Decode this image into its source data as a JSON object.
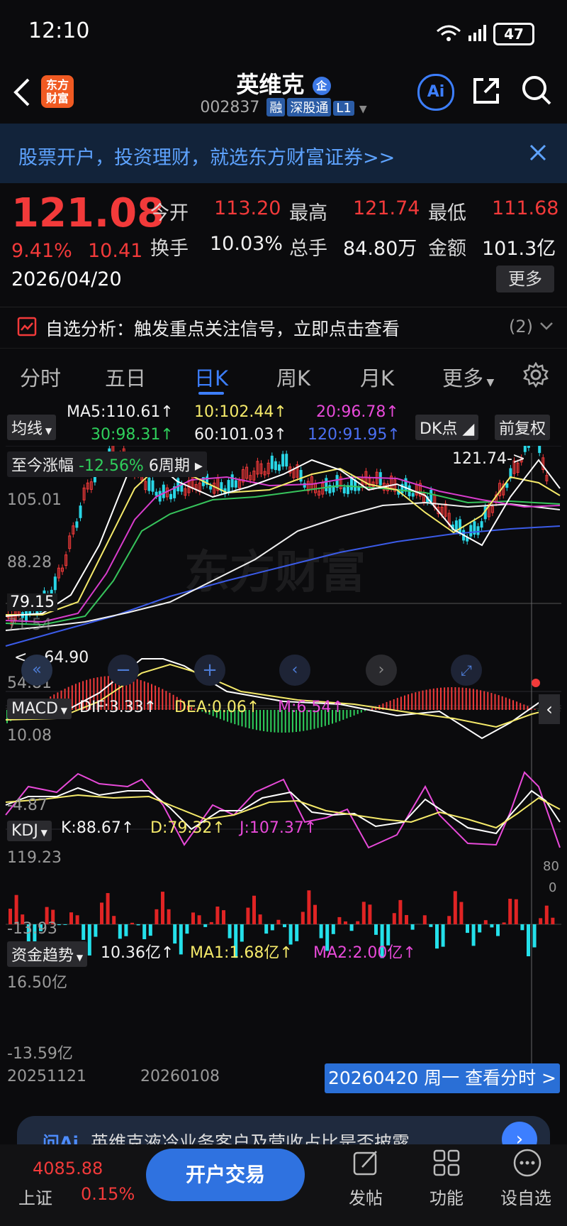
{
  "status_bar": {
    "time": "12:10",
    "battery": "47"
  },
  "header": {
    "logo_text_1": "东方",
    "logo_text_2": "财富",
    "title": "英维克",
    "code": "002837",
    "tags": [
      "融",
      "深股通",
      "L1"
    ]
  },
  "banner": {
    "text": "股票开户，投资理财，就选东方财富证券>>"
  },
  "quote": {
    "price": "121.08",
    "change_pct": "9.41%",
    "change": "10.41",
    "date": "2026/04/20",
    "open_label": "今开",
    "open": "113.20",
    "high_label": "最高",
    "high": "121.74",
    "low_label": "最低",
    "low": "111.68",
    "turnover_label": "换手",
    "turnover": "10.03%",
    "volume_label": "总手",
    "volume": "84.80万",
    "amount_label": "金额",
    "amount": "101.3亿",
    "more": "更多"
  },
  "analysis": {
    "text": "自选分析：触发重点关注信号，立即点击查看",
    "count": "(2)"
  },
  "tabs": [
    {
      "label": "分时"
    },
    {
      "label": "五日"
    },
    {
      "label": "日K"
    },
    {
      "label": "周K"
    },
    {
      "label": "月K"
    },
    {
      "label": "更多"
    }
  ],
  "ma": {
    "selector": "均线",
    "ma5": "MA5:110.61",
    "ma10": "10:102.44",
    "ma20": "20:96.78",
    "ma30": "30:98.31",
    "ma60": "60:101.03",
    "ma120": "120:91.95",
    "dk": "DK点",
    "fq": "前复权"
  },
  "period": {
    "label": "至今涨幅",
    "pct": "-12.56%",
    "cycles": "6周期"
  },
  "kline": {
    "y_labels": [
      "105.01",
      "88.28",
      "79.15",
      "71.54",
      "54.81"
    ],
    "high_mark": "121.74->",
    "low_mark": "<---64.90"
  },
  "macd": {
    "label": "MACD",
    "dif": "DIF:3.33",
    "dea": "DEA:0.06",
    "m": "M:6.54",
    "top": "10.08",
    "bottom": "-4.87"
  },
  "kdj": {
    "label": "KDJ",
    "k": "K:88.67",
    "d": "D:79.32",
    "j": "J:107.37",
    "top": "119.23",
    "bottom": "-13.93",
    "r80": "80",
    "r20": "0"
  },
  "fund": {
    "label": "资金趋势",
    "value": "10.36亿",
    "ma1": "MA1:1.68亿",
    "ma2": "MA2:2.00亿",
    "top": "16.50亿",
    "bottom": "-13.59亿"
  },
  "x_axis": {
    "start": "20251121",
    "mid": "20260108",
    "selected": "20260420 周一 查看分时 >"
  },
  "news": {
    "text": "英维克液冷业务客户及营收占比是否披露"
  },
  "bottom": {
    "index_value": "4085.88",
    "index_name": "上证",
    "index_pct": "0.15%",
    "trade": "开户交易",
    "post": "发帖",
    "func": "功能",
    "watch": "设自选"
  }
}
